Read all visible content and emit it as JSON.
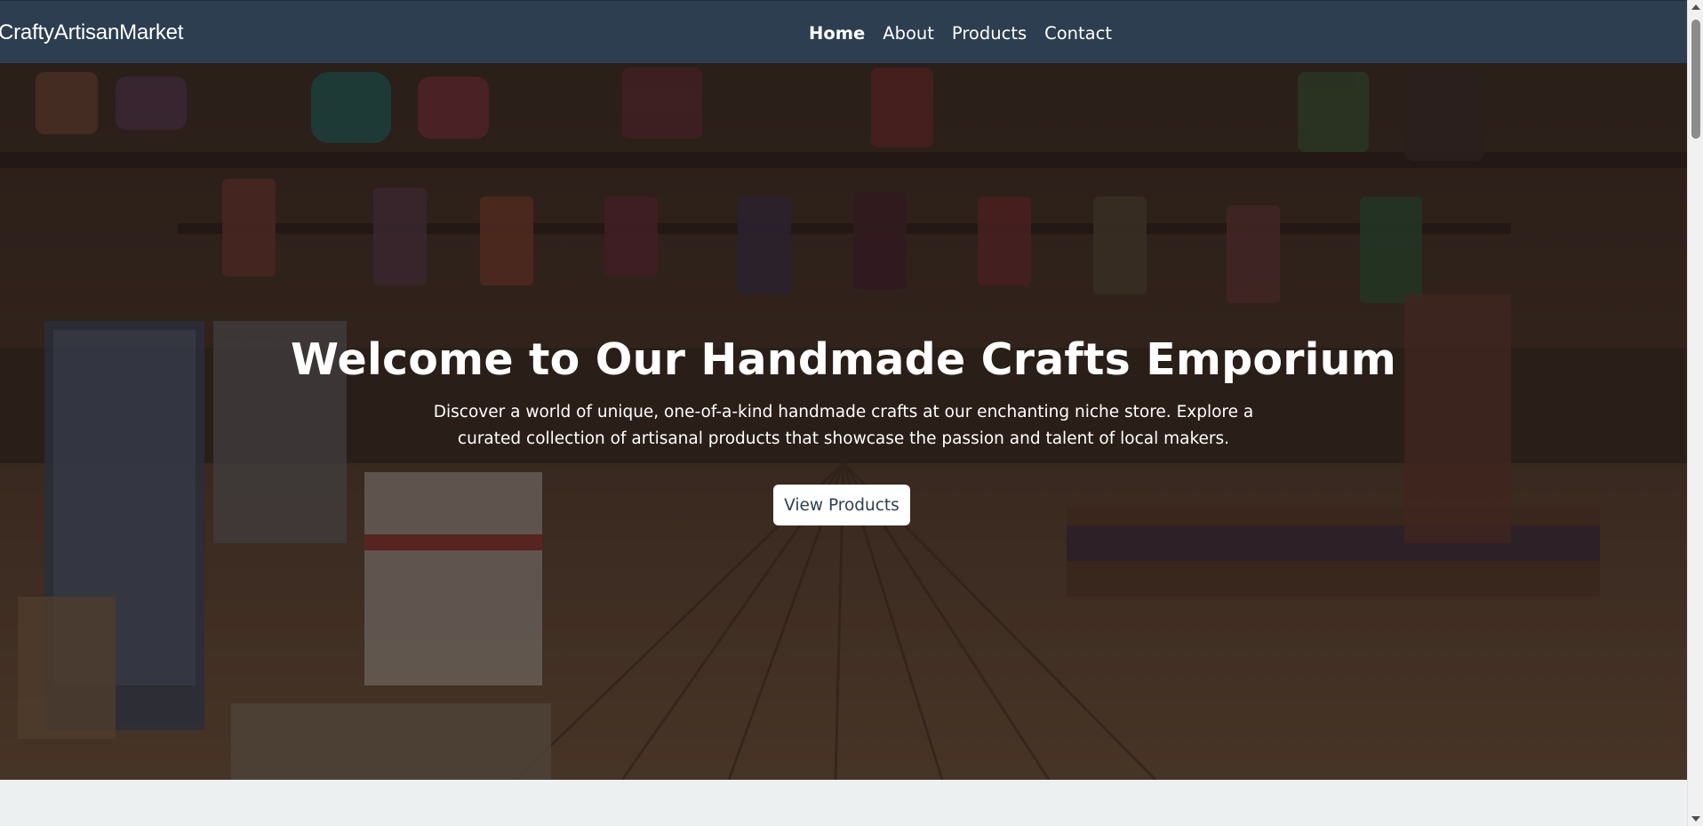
{
  "navbar": {
    "brand": "CraftyArtisanMarket",
    "links": [
      {
        "label": "Home",
        "active": true
      },
      {
        "label": "About",
        "active": false
      },
      {
        "label": "Products",
        "active": false
      },
      {
        "label": "Contact",
        "active": false
      }
    ]
  },
  "hero": {
    "title": "Welcome to Our Handmade Crafts Emporium",
    "description": "Discover a world of unique, one-of-a-kind handmade crafts at our enchanting niche store. Explore a curated collection of artisanal products that showcase the passion and talent of local makers.",
    "button_label": "View Products",
    "background_image": "craft-market-interior-photo"
  },
  "colors": {
    "navbar_bg": "#2c3e50",
    "page_bg": "#ecf0f1",
    "button_bg": "#ffffff",
    "text_light": "#ffffff"
  }
}
